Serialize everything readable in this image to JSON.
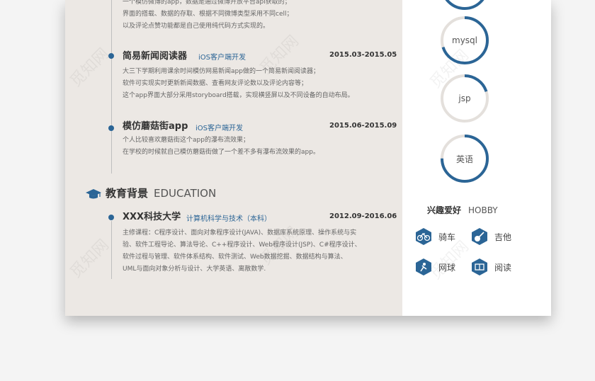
{
  "colors": {
    "accent": "#2b6596",
    "left_bg": "#ece8e4",
    "right_bg": "#ffffff"
  },
  "projects": [
    {
      "desc": [
        "一个模仿微博的app，数据是通过微博开放平台api获取的；",
        "界面的搭载、数据的存取、根据不同微博类型采用不同cell；",
        "以及评论点赞功能都是自己使用纯代码方式实现的。"
      ]
    },
    {
      "title": "简易新闻阅读器",
      "role": "iOS客户端开发",
      "date": "2015.03-2015.05",
      "desc": [
        "大三下学期利用课余时间模仿网易新闻app做的一个简易新闻阅读器；",
        "软件可实现实时更新新闻数据、查看网友评论数以及评论内容等；",
        "这个app界面大部分采用storyboard搭载，实现横竖屏以及不同设备的自动布局。"
      ]
    },
    {
      "title": "模仿蘑菇街app",
      "role": "iOS客户端开发",
      "date": "2015.06-2015.09",
      "desc": [
        "个人比较喜欢蘑菇街这个app的瀑布流效果；",
        "在学校的时候就自己模仿蘑菇街做了一个差不多有瀑布流效果的app。"
      ]
    }
  ],
  "education": {
    "section_cn": "教育背景",
    "section_en": "EDUCATION",
    "school": "XXX科技大学",
    "major": "计算机科学与技术（本科）",
    "date": "2012.09-2016.06",
    "desc": [
      "主修课程：C程序设计、面向对象程序设计(JAVA)、数据库系统原理、操作系统与实",
      "验、软件工程导论、算法导论、C++程序设计、Web程序设计(JSP)、C#程序设计、",
      "软件过程与管理、软件体系结构、软件测试、Web数据挖掘、数据结构与算法、",
      "UML与面向对象分析与设计、大学英语、离散数学."
    ]
  },
  "skills": [
    {
      "label": "",
      "level": 0.8
    },
    {
      "label": "mysql",
      "level": 0.7
    },
    {
      "label": "jsp",
      "level": 0.2
    },
    {
      "label": "英语",
      "level": 0.75
    }
  ],
  "hobby": {
    "title_cn": "兴趣爱好",
    "title_en": "HOBBY",
    "items": [
      {
        "label": "骑车",
        "icon": "bicycle-icon"
      },
      {
        "label": "吉他",
        "icon": "guitar-icon"
      },
      {
        "label": "网球",
        "icon": "tennis-icon"
      },
      {
        "label": "阅读",
        "icon": "book-icon"
      }
    ]
  },
  "watermark": "觅知网"
}
